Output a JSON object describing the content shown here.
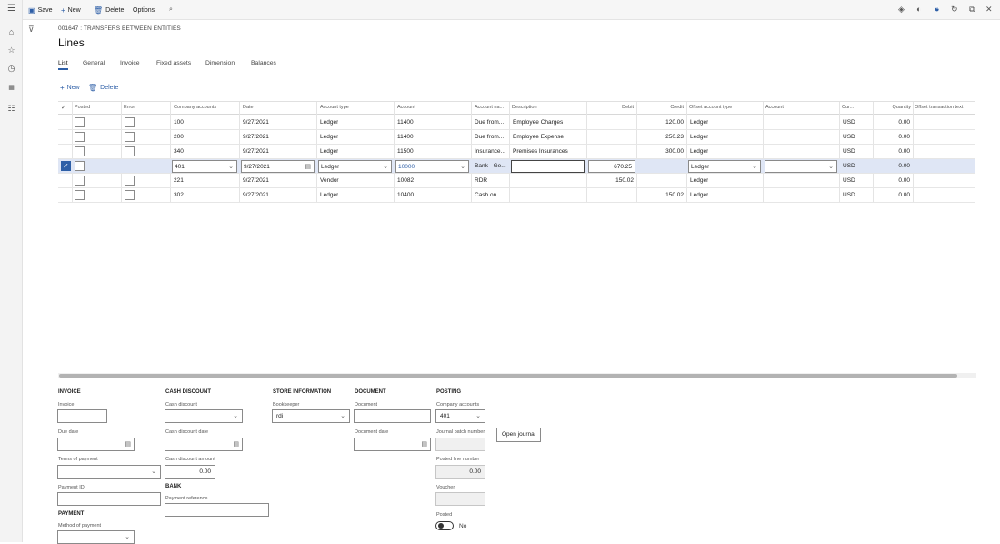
{
  "toolbar": {
    "save": "Save",
    "new": "New",
    "delete": "Delete",
    "options": "Options"
  },
  "page": {
    "breadcrumb": "001647 : TRANSFERS BETWEEN ENTITIES",
    "title": "Lines"
  },
  "tabs": [
    "List",
    "General",
    "Invoice",
    "Fixed assets",
    "Dimension",
    "Balances"
  ],
  "grid_toolbar": {
    "new": "New",
    "delete": "Delete"
  },
  "columns": [
    "Posted",
    "Error",
    "Company accounts",
    "Date",
    "Account type",
    "Account",
    "Account na...",
    "Description",
    "Debit",
    "Credit",
    "Offset account type",
    "Account",
    "Cur...",
    "Quantity",
    "Offset transaction text"
  ],
  "rows": [
    {
      "company": "100",
      "date": "9/27/2021",
      "type": "Ledger",
      "account": "11400",
      "account_name": "Due from...",
      "description": "Employee Charges",
      "debit": "",
      "credit": "120.00",
      "offset_type": "Ledger",
      "offset_account": "",
      "currency": "USD",
      "quantity": "0.00"
    },
    {
      "company": "200",
      "date": "9/27/2021",
      "type": "Ledger",
      "account": "11400",
      "account_name": "Due from...",
      "description": "Employee Expense",
      "debit": "",
      "credit": "250.23",
      "offset_type": "Ledger",
      "offset_account": "",
      "currency": "USD",
      "quantity": "0.00"
    },
    {
      "company": "340",
      "date": "9/27/2021",
      "type": "Ledger",
      "account": "11500",
      "account_name": "Insurance...",
      "description": "Premises Insurances",
      "debit": "",
      "credit": "300.00",
      "offset_type": "Ledger",
      "offset_account": "",
      "currency": "USD",
      "quantity": "0.00"
    },
    {
      "company": "401",
      "date": "9/27/2021",
      "type": "Ledger",
      "account": "10000",
      "account_name": "Bank - Ge...",
      "description": "",
      "debit": "670.25",
      "credit": "",
      "offset_type": "Ledger",
      "offset_account": "",
      "currency": "USD",
      "quantity": "0.00"
    },
    {
      "company": "221",
      "date": "9/27/2021",
      "type": "Vendor",
      "account": "10082",
      "account_name": "RDR",
      "description": "",
      "debit": "150.02",
      "credit": "",
      "offset_type": "Ledger",
      "offset_account": "",
      "currency": "USD",
      "quantity": "0.00"
    },
    {
      "company": "302",
      "date": "9/27/2021",
      "type": "Ledger",
      "account": "10400",
      "account_name": "Cash on ...",
      "description": "",
      "debit": "",
      "credit": "150.02",
      "offset_type": "Ledger",
      "offset_account": "",
      "currency": "USD",
      "quantity": "0.00"
    }
  ],
  "invoice": {
    "section": "INVOICE",
    "invoice_label": "Invoice",
    "invoice_value": "",
    "due_date_label": "Due date",
    "due_date_value": "",
    "terms_label": "Terms of payment",
    "terms_value": "",
    "payment_id_label": "Payment ID",
    "payment_id_value": ""
  },
  "payment": {
    "section": "PAYMENT",
    "method_label": "Method of payment",
    "method_value": ""
  },
  "cash_discount": {
    "section": "CASH DISCOUNT",
    "discount_label": "Cash discount",
    "discount_value": "",
    "date_label": "Cash discount date",
    "date_value": "",
    "amount_label": "Cash discount amount",
    "amount_value": "0.00"
  },
  "bank": {
    "section": "BANK",
    "reference_label": "Payment reference",
    "reference_value": ""
  },
  "store": {
    "section": "STORE INFORMATION",
    "bookkeeper_label": "Bookkeeper",
    "bookkeeper_value": "rdi"
  },
  "document": {
    "section": "DOCUMENT",
    "document_label": "Document",
    "document_value": "",
    "date_label": "Document date",
    "date_value": ""
  },
  "posting": {
    "section": "POSTING",
    "company_label": "Company accounts",
    "company_value": "401",
    "batch_label": "Journal batch number",
    "batch_value": "",
    "open_journal": "Open journal",
    "line_label": "Posted line number",
    "line_value": "0.00",
    "voucher_label": "Voucher",
    "voucher_value": "",
    "posted_label": "Posted",
    "posted_value": "No"
  },
  "icons": {
    "menu": "hamburger-icon",
    "home": "home-icon",
    "favorites": "star-icon",
    "recent": "clock-icon",
    "workspaces": "workspace-icon",
    "modules": "list-icon"
  },
  "colors": {
    "accent": "#2e5fa7",
    "selected_row": "#dfe6f5",
    "notification": "#2e5fa7"
  },
  "notification_count": "6"
}
